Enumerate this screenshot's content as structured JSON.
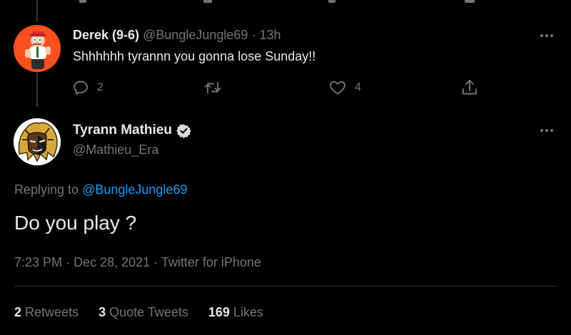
{
  "reply_tweet": {
    "display_name": "Derek (9-6)",
    "handle": "@BungleJungle69",
    "separator": "·",
    "time_ago": "13h",
    "text": "Shhhhhh tyrannn you gonna lose Sunday!!",
    "reply_count": "2",
    "like_count": "4",
    "avatar_icon": "peter-griffin-avatar"
  },
  "main_tweet": {
    "display_name": "Tyrann Mathieu",
    "handle": "@Mathieu_Era",
    "replying_to_prefix": "Replying to",
    "replying_to_handle": "@BungleJungle69",
    "text": "Do you play ?",
    "time": "7:23 PM",
    "dot1": "·",
    "date": "Dec 28, 2021",
    "dot2": "·",
    "source": "Twitter for iPhone",
    "verified_icon": "verified-badge-icon",
    "avatar_icon": "lion-mane-avatar"
  },
  "stats": {
    "retweets_count": "2",
    "retweets_label": "Retweets",
    "quote_count": "3",
    "quote_label": "Quote Tweets",
    "likes_count": "169",
    "likes_label": "Likes"
  },
  "colors": {
    "background": "#000000",
    "text_primary": "#e7e9ea",
    "text_muted": "#71767b",
    "accent_link": "#1d9bf0",
    "divider": "#2f3336",
    "avatar_derek_bg": "#fa4f1e"
  }
}
